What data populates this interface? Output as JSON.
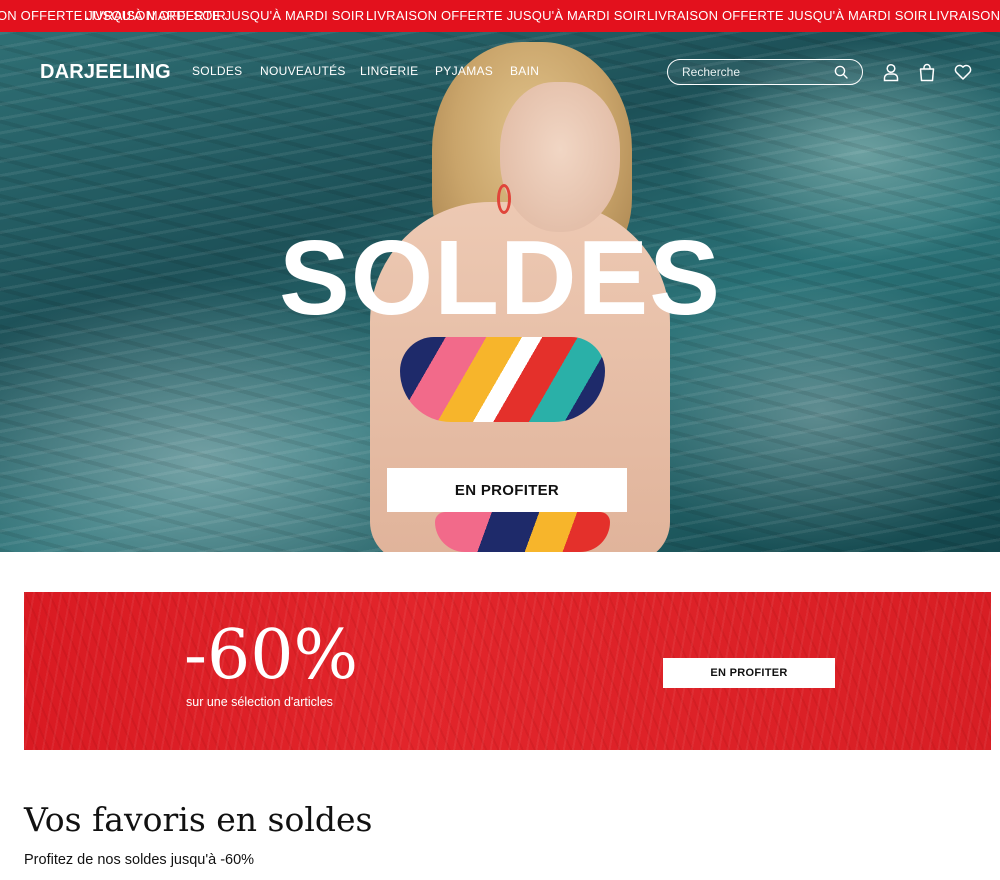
{
  "announcement": {
    "messages": [
      "IRAISON OFFERTE JUSQU'À MARDI SOIR",
      "LIVRAISON OFFERTE JUSQU'À MARDI SOIR",
      "LIVRAISON OFFERTE JUSQU'À MARDI SOIR",
      "LIVRAISON OFFERTE JUSQU'À MARDI SOIR",
      "LIVRAISON OFFERTE JUSQU'À MARDI SOIR"
    ],
    "background": "#e3111d"
  },
  "header": {
    "logo": "DARJEELING",
    "nav": [
      "SOLDES",
      "NOUVEAUTÉS",
      "LINGERIE",
      "PYJAMAS",
      "BAIN"
    ],
    "search": {
      "placeholder": "Recherche",
      "value": ""
    },
    "icons": [
      "search-icon",
      "account-icon",
      "bag-icon",
      "heart-icon"
    ]
  },
  "hero": {
    "title": "SOLDES",
    "cta_label": "EN PROFITER"
  },
  "promo": {
    "percent": "-60%",
    "subtitle": "sur une sélection d'articles",
    "cta_label": "EN PROFITER",
    "background": "#e2252b"
  },
  "section": {
    "title": "Vos favoris en soldes",
    "subtitle": "Profitez de nos soldes jusqu'à -60%"
  }
}
